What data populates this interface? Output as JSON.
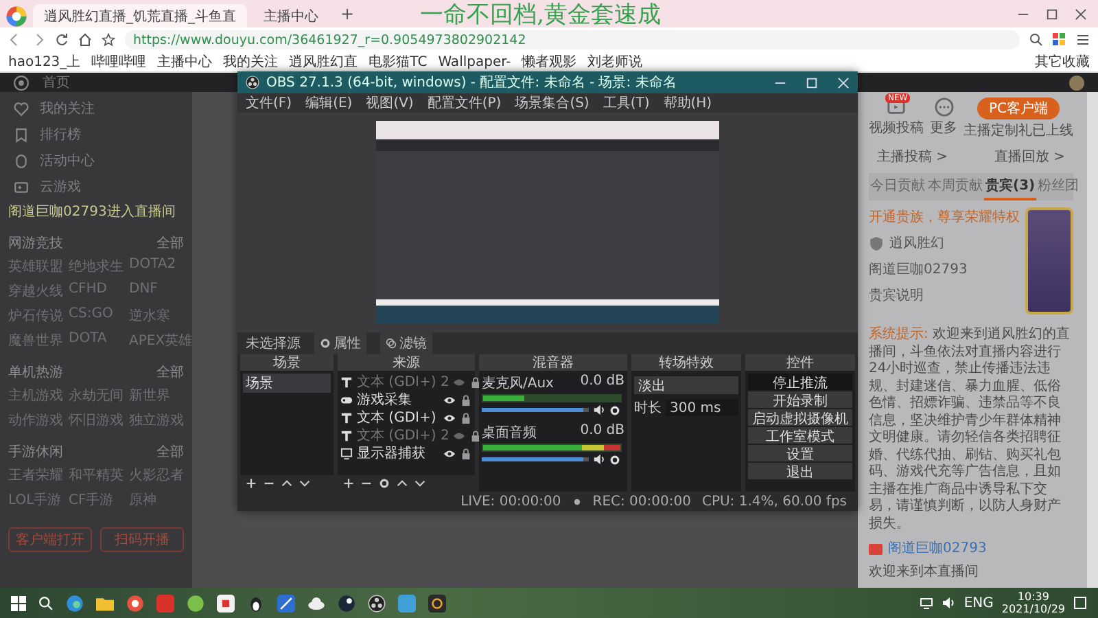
{
  "browser": {
    "tabs": [
      {
        "label": "逍风胜幻直播_饥荒直播_斗鱼直",
        "selected": true
      },
      {
        "label": "主播中心",
        "selected": false
      }
    ],
    "new_tab": "+",
    "overlay_text": "一命不回档,黄金套速成",
    "url": "https://www.douyu.com/36461927_r=0.9054973802902142",
    "bookmarks": [
      "hao123_上",
      "哔哩哔哩",
      "主播中心",
      "我的关注",
      "逍风胜幻直",
      "电影猫TC",
      "Wallpaper-",
      "懒者观影",
      "刘老师说"
    ],
    "other_bookmarks": "其它收藏"
  },
  "site": {
    "home": "首页",
    "sidebar": {
      "nav": [
        "我的关注",
        "排行榜",
        "活动中心",
        "云游戏"
      ],
      "notice": "阁道巨咖02793进入直播间",
      "sections": [
        {
          "title": "网游竞技",
          "more": "全部",
          "items": [
            "英雄联盟",
            "绝地求生",
            "DOTA2",
            "穿越火线",
            "CFHD",
            "DNF",
            "炉石传说",
            "CS:GO",
            "逆水寒",
            "魔兽世界",
            "DOTA",
            "APEX英雄"
          ]
        },
        {
          "title": "单机热游",
          "more": "全部",
          "items": [
            "主机游戏",
            "永劫无间",
            "新世界",
            "动作游戏",
            "怀旧游戏",
            "独立游戏"
          ]
        },
        {
          "title": "手游休闲",
          "more": "全部",
          "items": [
            "王者荣耀",
            "和平精英",
            "火影忍者",
            "LOL手游",
            "CF手游",
            "原神"
          ]
        }
      ],
      "buttons": [
        "客户端打开",
        "扫码开播"
      ]
    }
  },
  "obs": {
    "title": "OBS 27.1.3 (64-bit, windows) - 配置文件: 未命名 - 场景: 未命名",
    "menu": [
      "文件(F)",
      "编辑(E)",
      "视图(V)",
      "配置文件(P)",
      "场景集合(S)",
      "工具(T)",
      "帮助(H)"
    ],
    "source_bar": {
      "label": "未选择源",
      "buttons": [
        "属性",
        "滤镜"
      ]
    },
    "docks": {
      "scenes": {
        "title": "场景",
        "items": [
          {
            "label": "场景",
            "selected": true
          }
        ]
      },
      "sources": {
        "title": "来源",
        "items": [
          {
            "label": "文本 (GDI+) 2",
            "kind": "text",
            "visible": false
          },
          {
            "label": "游戏采集",
            "kind": "game",
            "visible": true
          },
          {
            "label": "文本 (GDI+)",
            "kind": "text",
            "visible": true
          },
          {
            "label": "文本 (GDI+) 2",
            "kind": "text",
            "visible": false
          },
          {
            "label": "显示器捕获",
            "kind": "display",
            "visible": true
          }
        ]
      },
      "mixer": {
        "title": "混音器",
        "channels": [
          {
            "name": "麦克风/Aux",
            "reading": "0.0 dB",
            "meter": {
              "level": 0.3
            },
            "volume": {
              "level": 0.95
            }
          },
          {
            "name": "桌面音频",
            "reading": "0.0 dB",
            "meter": {
              "level": 1.0
            },
            "volume": {
              "level": 0.95
            }
          }
        ]
      },
      "transitions": {
        "title": "转场特效",
        "type": "淡出",
        "duration_label": "时长",
        "duration": "300 ms"
      },
      "controls": {
        "title": "控件",
        "buttons": [
          {
            "label": "停止推流",
            "active": true
          },
          {
            "label": "开始录制",
            "active": false
          },
          {
            "label": "启动虚拟摄像机",
            "active": false
          },
          {
            "label": "工作室模式",
            "active": false
          },
          {
            "label": "设置",
            "active": false
          },
          {
            "label": "退出",
            "active": false
          }
        ]
      }
    },
    "status": {
      "live": "LIVE: 00:00:00",
      "rec": "REC: 00:00:00",
      "cpu": "CPU: 1.4%, 60.00 fps"
    }
  },
  "right_panel": {
    "video_upload": "视频投稿",
    "upload_badge": "NEW",
    "more": "更多",
    "client_button": "PC客户端",
    "client_note": "主播定制礼已上线",
    "links": [
      "主播投稿 >",
      "直播回放 >"
    ],
    "tabs": [
      {
        "label": "今日贡献",
        "selected": false
      },
      {
        "label": "本周贡献",
        "selected": false
      },
      {
        "label": "贵宾(3)",
        "selected": true
      },
      {
        "label": "粉丝团",
        "selected": false
      }
    ],
    "noble_text": "开通贵族，尊享荣耀特权",
    "guests": [
      "逍风胜幻",
      "阁道巨咖02793",
      "贵宾说明"
    ],
    "system_tag": "系统提示:",
    "system_text": "欢迎来到逍风胜幻的直播间，斗鱼依法对直播内容进行24小时巡查，禁止传播违法违规、封建迷信、暴力血腥、低俗色情、招嫖诈骗、违禁品等不良信息，坚决维护青少年群体精神文明健康。请勿轻信各类招聘征婚、代练代抽、刷钻、购买礼包码、游戏代充等广告信息，且如主播在推广商品中诱导私下交易，请谨慎判断，以防人身财产损失。",
    "welcome_user": "阁道巨咖02793",
    "welcome_text": "欢迎来到本直播间"
  },
  "taskbar": {
    "language": "ENG",
    "time": "10:39",
    "date": "2021/10/29"
  }
}
